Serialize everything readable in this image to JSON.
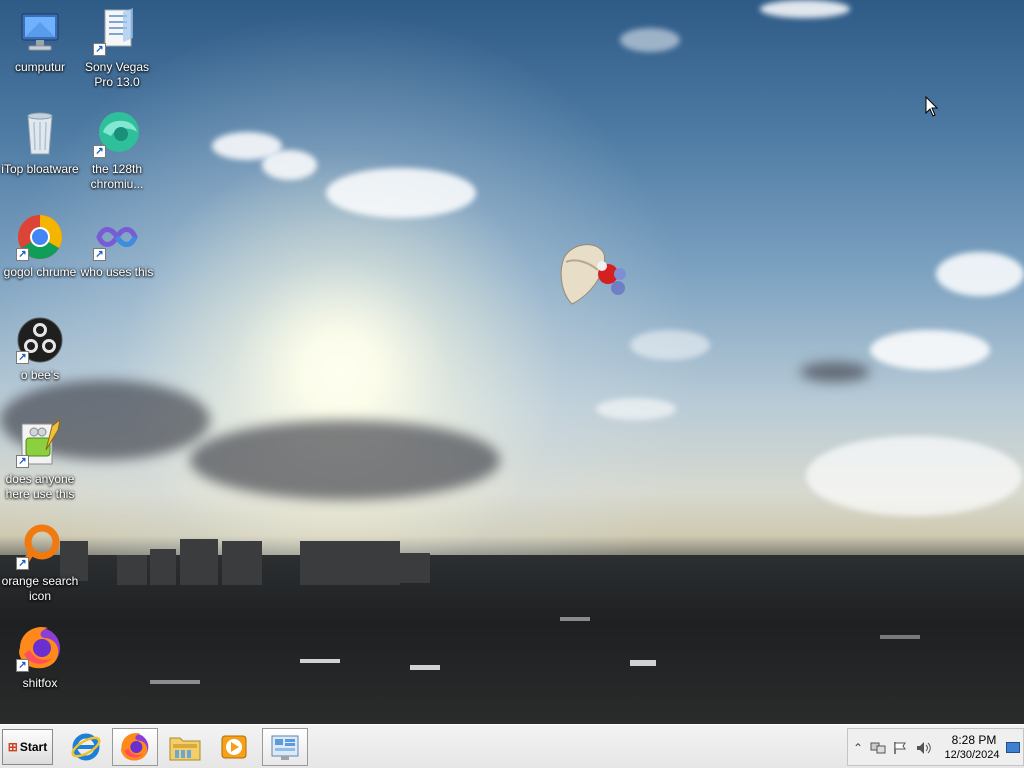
{
  "desktop": {
    "icons": [
      {
        "label": "cumputur",
        "icon": "computer-icon",
        "shortcut": false
      },
      {
        "label": "Sony Vegas Pro 13.0",
        "icon": "sony-vegas-icon",
        "shortcut": true
      },
      {
        "label": "iTop bloatware",
        "icon": "recycle-bin-icon",
        "shortcut": false
      },
      {
        "label": "the 128th chromiu...",
        "icon": "chromium-edge-icon",
        "shortcut": true
      },
      {
        "label": "gogol chrume",
        "icon": "chrome-icon",
        "shortcut": true
      },
      {
        "label": "who uses this",
        "icon": "visual-studio-icon",
        "shortcut": true
      },
      {
        "label": "o bee's",
        "icon": "obs-icon",
        "shortcut": true
      },
      {
        "label": "does anyone here use this",
        "icon": "notepad-plus-plus-icon",
        "shortcut": true
      },
      {
        "label": "orange search icon",
        "icon": "orange-search-icon",
        "shortcut": true
      },
      {
        "label": "shitfox",
        "icon": "firefox-icon",
        "shortcut": true
      }
    ]
  },
  "taskbar": {
    "start_label": "Start",
    "pinned": [
      {
        "name": "internet-explorer",
        "icon": "internet-explorer-icon",
        "active": false
      },
      {
        "name": "firefox",
        "icon": "firefox-icon",
        "active": true
      },
      {
        "name": "file-explorer",
        "icon": "folder-icon",
        "active": false
      },
      {
        "name": "media-player",
        "icon": "media-player-icon",
        "active": false
      },
      {
        "name": "control-panel",
        "icon": "control-panel-icon",
        "active": false
      }
    ],
    "tray": {
      "clock_time": "8:28 PM",
      "clock_date": "12/30/2024",
      "icons": [
        "show-hidden-icon",
        "network-icon",
        "action-center-flag-icon",
        "volume-icon"
      ]
    }
  }
}
